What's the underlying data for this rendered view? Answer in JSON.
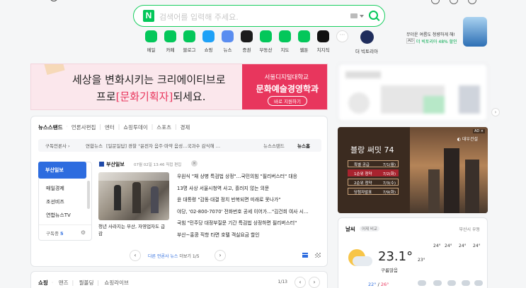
{
  "search": {
    "placeholder": "검색어를 입력해 주세요."
  },
  "shortcuts": [
    {
      "label": "메일",
      "icon": "mail-icon",
      "color": "#03c75a"
    },
    {
      "label": "카페",
      "icon": "cafe-icon",
      "color": "#03c75a"
    },
    {
      "label": "블로그",
      "icon": "blog-icon",
      "color": "#03c75a"
    },
    {
      "label": "쇼핑",
      "icon": "shopping-icon",
      "color": "#1ea1f7"
    },
    {
      "label": "뉴스",
      "icon": "news-icon",
      "color": "#5a8df0"
    },
    {
      "label": "증권",
      "icon": "stock-icon",
      "color": "#1b1b1b"
    },
    {
      "label": "부동산",
      "icon": "realestate-icon",
      "color": "#03c75a"
    },
    {
      "label": "지도",
      "icon": "map-icon",
      "color": "#03c75a"
    },
    {
      "label": "웹툰",
      "icon": "webtoon-icon",
      "color": "#03c75a"
    },
    {
      "label": "치지직",
      "icon": "chzzk-icon",
      "color": "#111111"
    },
    {
      "label": "",
      "icon": "more-icon",
      "color": "#ffffff"
    },
    {
      "label": "더 빅토리아",
      "icon": "victoria-icon",
      "color": "#1f2d5c"
    }
  ],
  "top_ad": {
    "line1": "무더운 여름도 청량하게 해!",
    "tag": "AD",
    "line2": "더 빅토리아 48% 할인"
  },
  "banner": {
    "line1": "세상을 변화시키는 크리에이티브로",
    "line2_pre": "프로",
    "line2_hl": "[문화기획자]",
    "line2_post": "되세요.",
    "school": "서울디지털대학교",
    "dept": "문화예술경영학과",
    "cta": "바로 지원하기"
  },
  "newsstand": {
    "tabs": [
      "뉴스스탠드",
      "언론사편집",
      "엔터",
      "쇼핑투데이",
      "스포츠",
      "경제"
    ],
    "bar": {
      "category": "구독언론사 ›",
      "source": "연합뉴스",
      "ticker": "[일문일답] 경찰 \"윤전자 음주·마약 음성…국과수 감식해 …",
      "standlink": "뉴스스탠드",
      "home": "뉴스홈"
    },
    "press_list": [
      "부산일보",
      "매일경제",
      "조선비즈",
      "연합뉴스TV"
    ],
    "subscribed_label": "구독중",
    "subscribed_count": "5",
    "press": {
      "name": "부산일보",
      "date": "07월 02일 13:46 직접 편집"
    },
    "photo_caption": "청년 사라지는 부산, 자영업자도 급감",
    "headlines": [
      "우원식 \"채 상병 특검법 상정\"…국민의힘 \"필리버스터\" 대응",
      "13명 사상 서울시청역 사고, 흘러지 않는 의문",
      "윤 대통령 \"감동·대결 정치 반복되면 미래로 못나가\"",
      "야당, '02-800-7070' 전화번호 공세 이어가…\"김건희 여사 시…",
      "국힘 \"민주당 대정부질문 기간 특검법 상정하면 필리버스터\"",
      "부산~홍콩 직항 타면 호텔 객실요금 할인"
    ],
    "pager_text_pre": "다른 언론사 뉴스",
    "pager_text_post": "더보기 1/5"
  },
  "shopping": {
    "tabs": [
      "쇼핑",
      "맨즈",
      "뭘볼딩",
      "쇼핑라이브"
    ],
    "page": "1/13"
  },
  "right_ad": {
    "tag": "AD ×",
    "brand": "◐ 대우건설",
    "title": "블랑 써밋 74",
    "rows": [
      {
        "k": "특별 공급",
        "v": "7/1(월)"
      },
      {
        "k": "1순위 청약",
        "v": "7/2(화)"
      },
      {
        "k": "2순위 청약",
        "v": "7/3(수)"
      },
      {
        "k": "당첨자발표",
        "v": "7/9(화)"
      }
    ]
  },
  "weather": {
    "title": "날씨",
    "compare": "어제 비교",
    "location": "부산시 우동",
    "temp": "23.1°",
    "desc": "구름많음",
    "low": "22°",
    "high": "26°",
    "hours": [
      "24°",
      "24°",
      "24°",
      "24°"
    ],
    "hour_low": "23°"
  }
}
